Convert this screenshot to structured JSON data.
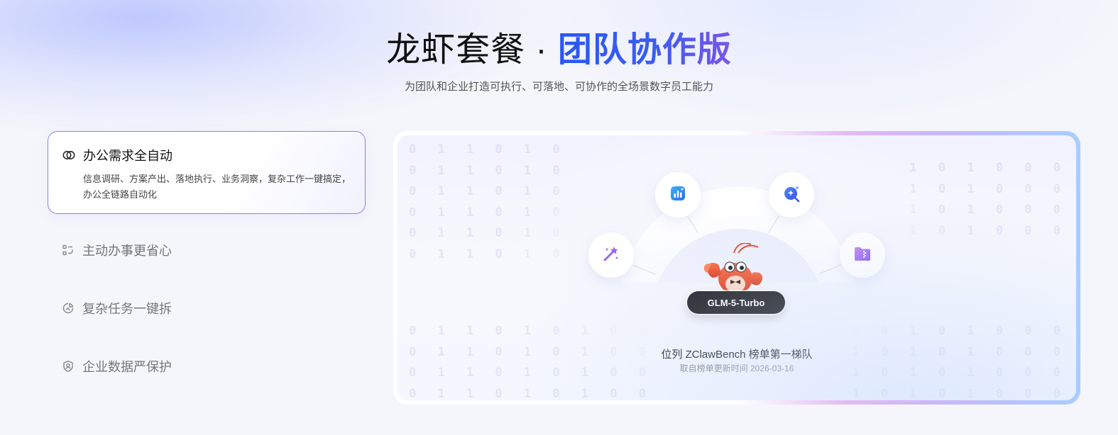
{
  "hero": {
    "title_prefix": "龙虾套餐 · ",
    "title_accent": "团队协作版",
    "subtitle": "为团队和企业打造可执行、可落地、可协作的全场景数字员工能力"
  },
  "features": {
    "active": {
      "title": "办公需求全自动",
      "description": "信息调研、方案产出、落地执行、业务洞察，复杂工作一键搞定，办公全链路自动化",
      "icon": "double-circle-icon"
    },
    "items": [
      {
        "title": "主动办事更省心",
        "icon": "workflow-icon"
      },
      {
        "title": "复杂任务一键拆",
        "icon": "pie-split-icon"
      },
      {
        "title": "企业数据严保护",
        "icon": "shield-user-icon"
      }
    ]
  },
  "showcase": {
    "model_name": "GLM-5-Turbo",
    "rank_text": "位列 ZClawBench 榜单第一梯队",
    "rank_source": "取自榜单更新时间 2026-03-16",
    "nodes": [
      {
        "name": "magic-wand-icon",
        "color": "#8b5cf6"
      },
      {
        "name": "chart-icon",
        "color": "#2f8df5"
      },
      {
        "name": "sparkle-search-icon",
        "color": "#3b6cf6"
      },
      {
        "name": "folder-zip-icon",
        "color": "#a35cf0"
      }
    ],
    "binary_text": {
      "left": "0 1 1 0 1 0\n0 1 1 0 1 0\n0 1 1 0 1 0\n0 1 1 0 1 0\n0 1 1 0 1 0\n0 1 1 0 1 0",
      "right": "1 0 1 0 0 0\n1 0 1 0 0 0\n1 0 1 0 0 0\n1 0 1 0 0 0",
      "bottom_left": "0 1 1 0 1 0 1 0 0\n0 1 1 0 1 0 1 0 0\n0 1 1 0 1 0 1 0 0\n0 1 1 0 1 0 1 0 0",
      "bottom_right": "1 0 1 0 1 0 0 0\n1 0 1 0 1 0 0 0\n1 0 1 0 1 0 0 0\n1 0 1 0 1 0 0 0"
    }
  }
}
